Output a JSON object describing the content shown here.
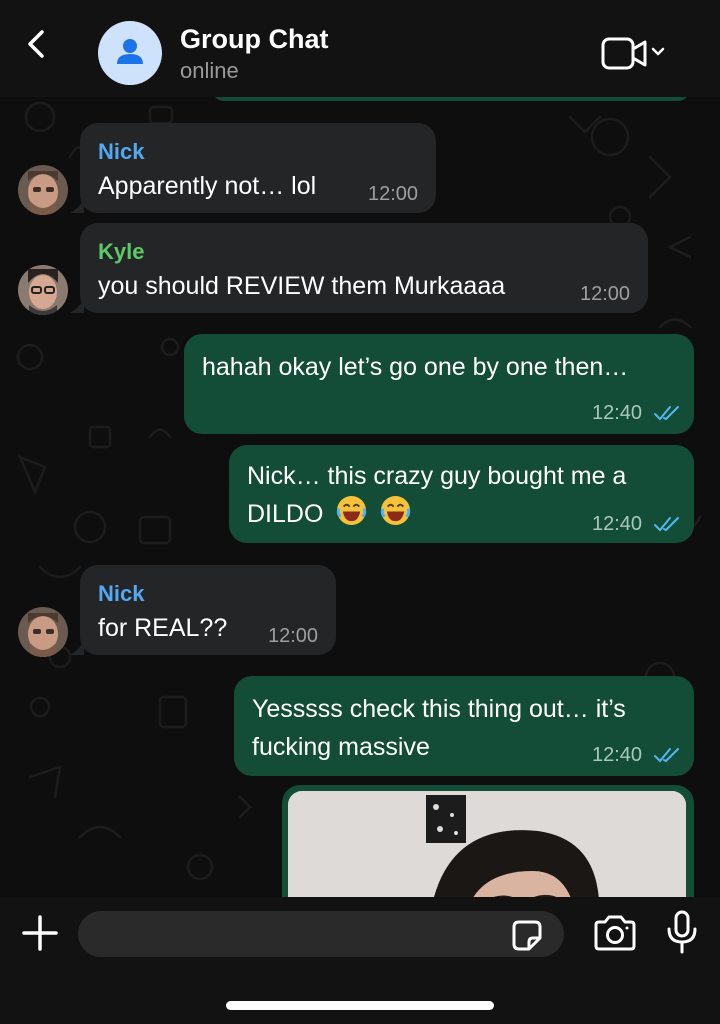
{
  "header": {
    "title": "Group Chat",
    "status": "online"
  },
  "messages": [
    {
      "sender": "Nick",
      "text": "Apparently not… lol",
      "time": "12:00"
    },
    {
      "sender": "Kyle",
      "text": "you should REVIEW them Murkaaaa",
      "time": "12:00"
    },
    {
      "text": "hahah okay let’s go one by one then…",
      "time": "12:40"
    },
    {
      "line1": "Nick… this crazy guy bought me a",
      "line2": "DILDO",
      "time": "12:40"
    },
    {
      "sender": "Nick",
      "text": "for REAL??",
      "time": "12:00"
    },
    {
      "line1": "Yesssss check this thing out… it’s",
      "line2": "fucking massive",
      "time": "12:40"
    }
  ],
  "colors": {
    "nick_name": "#53a8f0",
    "kyle_name": "#5cc96a",
    "incoming_bubble": "#242526",
    "outgoing_bubble": "#134d37",
    "read_ticks": "#53b8f0"
  },
  "composer": {
    "placeholder": ""
  },
  "icons": [
    "back-chevron-icon",
    "person-icon",
    "video-call-icon",
    "plus-icon",
    "sticker-icon",
    "camera-icon",
    "microphone-icon",
    "read-receipt-icon",
    "laughing-emoji-icon"
  ]
}
